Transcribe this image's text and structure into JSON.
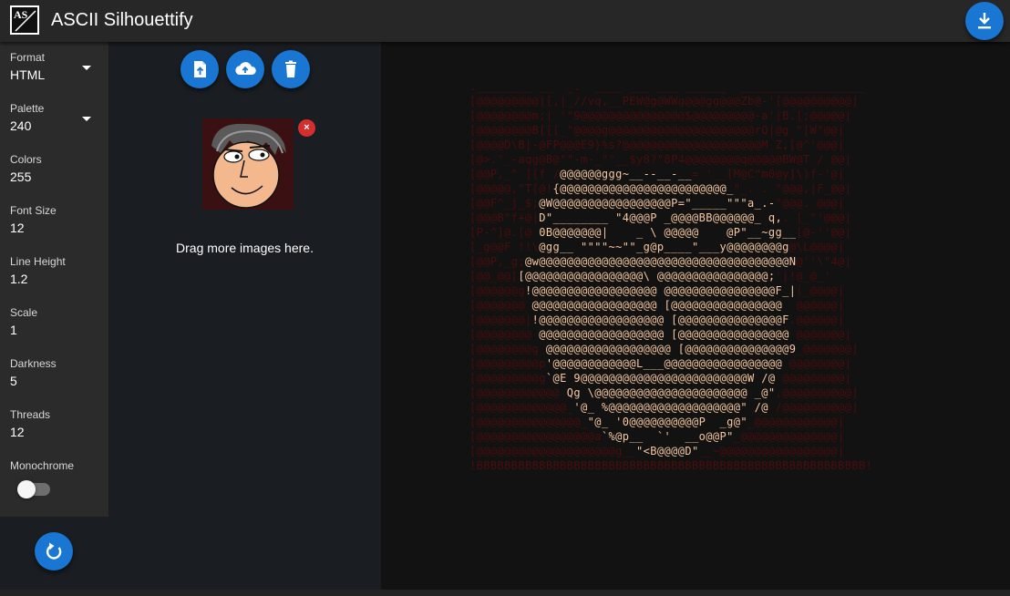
{
  "app": {
    "title": "ASCII Silhouettify",
    "logo_text": "AS"
  },
  "settings": [
    {
      "label": "Format",
      "value": "HTML",
      "dropdown": true
    },
    {
      "label": "Palette",
      "value": "240",
      "dropdown": true
    },
    {
      "label": "Colors",
      "value": "255"
    },
    {
      "label": "Font Size",
      "value": "12"
    },
    {
      "label": "Line Height",
      "value": "1.2"
    },
    {
      "label": "Scale",
      "value": "1"
    },
    {
      "label": "Darkness",
      "value": "5"
    },
    {
      "label": "Threads",
      "value": "12"
    },
    {
      "label": "Monochrome",
      "value": ""
    }
  ],
  "monochrome_enabled": false,
  "upload": {
    "remove_badge": "×",
    "drag_text": "Drag more images here."
  },
  "icons": {
    "download": "download-icon",
    "reset": "refresh-icon",
    "open_file": "file-upload-icon",
    "upload_cloud": "cloud-upload-icon",
    "delete": "delete-icon"
  },
  "colors": {
    "accent": "#1976d2",
    "ascii_dim": "#4a0d0d",
    "ascii_bright": "#f6c7a0",
    "remove": "#d32f2f"
  },
  "ascii_lines": [
    {
      "dim": ".________ __  _.  ____ ___ ___ ______  __________________"
    },
    {
      "dim": "[@@@@@@@@@|[,|_//vq,__PEW@g@WWg@@@gg@@@Zb@-'[@@@@@@@@@@|"
    },
    {
      "dim": "[@@@@@@@@m;| '\"9@@@@@@@@@@@@@@@$@@@@@@@@@-a'|B.[;@@@@@|"
    },
    {
      "dim": "[@@@@@@@@B[[[_\"@@@@g@@@@@@@@@@@@@@@@@@@@@rQ|@g \"[W\"@@|"
    },
    {
      "dim": "[@@@@D\\B|-@FP@@@E9}%s?@@@@@@@@@@@@@@@@@@@@M Z,[@^'@@@|"
    },
    {
      "dim": "[@>.\"_-aqg@B@\"\"-m-_\"\"__$y8?\"8P4@@@@@@@@q@@@@@BW@T / @@|"
    },
    {
      "dim": "[@@P,_^ ][f /",
      "bright": "@@@@@@ggg~__--__-__",
      "tail": "= '__[M@C\"m0@y]\\)f-'@|"
    },
    {
      "dim": "[@@@@@,\"T[@!",
      "bright": "{@@@@@@@@@@@@@@@@@@@@@@@@_",
      "tail": "\"_. . \"@@@,|F_@@|"
    },
    {
      "dim": "[@@F^_j_$;",
      "bright": "@W@@@@@@@@@@@@@@@@@P=\"_____\"\"\"a_.-",
      "tail": "\"@@@. @@@|"
    },
    {
      "dim": "[@@@B\"f+@|",
      "bright": "D\"________ \"4@@@P _@@@@BB@@@@@@_ q,",
      "tail": ". [_\"'@@@|"
    },
    {
      "dim": "[P-^]@.[@ ",
      "bright": "0B@@@@@@@|    _ \\ @@@@@    @P\"__~gg__",
      "tail": "[@-''@@|"
    },
    {
      "dim": "[_g@@F !!\\",
      "bright": "@gg__ \"\"\"\"~~\"\"_g@p____\"___y@@@@@@@@g",
      "tail": "@\\L@@@@|"
    },
    {
      "dim": "[@@P,_g;",
      "bright": "@w@@@@@@@@@@@@@@@@@@@@@@@@@@@@@@@@@@@@N",
      "tail": "@''\\\"4@|"
    },
    {
      "dim": "[@@_@@[",
      "bright": "[@@@@@@@@@@@@@@@@@\\ @@@@@@@@@@@@@@@@;",
      "tail": "'|!@_@_'"
    },
    {
      "dim": "[@@@@@@g",
      "bright": "!@@@@@@@@@@@@@@@@@@ @@@@@@@@@@@@@@@@F_|",
      "tail": "(_@@@@|"
    },
    {
      "dim": "[@@@@@@@ ",
      "bright": "@@@@@@@@@@@@@@@@@@ [@@@@@@@@@@@@@@@@",
      "tail": "  @@@@@@|"
    },
    {
      "dim": "[@@@@@@@|",
      "bright": "!@@@@@@@@@@@@@@@@@@ [@@@@@@@@@@@@@@@F",
      "tail": ".@@@@@@|"
    },
    {
      "dim": "[@@@@@@@@ ",
      "bright": "@@@@@@@@@@@@@@@@@@ [@@@@@@@@@@@@@@@@",
      "tail": " @@@@@@@|"
    },
    {
      "dim": "[@@@@@@@@g ",
      "bright": "@@@@@@@@@@@@@@@@@@ [@@@@@@@@@@@@@@@9",
      "tail": "_@@@@@@@|"
    },
    {
      "dim": "[@@@@@@@@@p",
      "bright": "'@@@@@@@@@@@@L___@@@@@@@@@@@@@@@@@",
      "tail": " @@@@@@@@|"
    },
    {
      "dim": "[@@@@@@@@@g",
      "bright": "`@E 9@@@@@@@@@@@@@@@@@@@@@@@@W /@",
      "tail": " @@@@@@@@@|"
    },
    {
      "dim": "[@@@@@@@@@@@@ ",
      "bright": "Qg \\@@@@@@@@@@@@@@@@@@@@@@ _@\"",
      "tail": ",@@@@@@@@@@|"
    },
    {
      "dim": "[@@@@@@@@@@@@@_",
      "bright": "'@_ %@@@@@@@@@@@@@@@@@@@\" /@",
      "tail": " /@@@@@@@@@@|"
    },
    {
      "dim": "[@@@@@@@@@@@@@@@_",
      "bright": "\"@_ '0@@@@@@@@@@P  _g@\"",
      "tail": "_@@@@@@@@@@@@|"
    },
    {
      "dim": "[@@@@@@@@@@@@@@@@@a",
      "bright": "`%@p__  `'  __o@@P\"",
      "tail": "_@@@@@@@@@@@@@@|"
    },
    {
      "dim": "[@@@@@@@@@@@@@@@@@@@@g__",
      "bright": "\"<B@@@@D\"",
      "tail": "__~@@@@@@@@@@@@@@@@@|"
    },
    {
      "dim": "!BBBBBBBBBBBBBBBBBBBBBBBBBBBBBBBBBBBBBBBBBBBBBBBBBBBBBBBB!"
    }
  ]
}
